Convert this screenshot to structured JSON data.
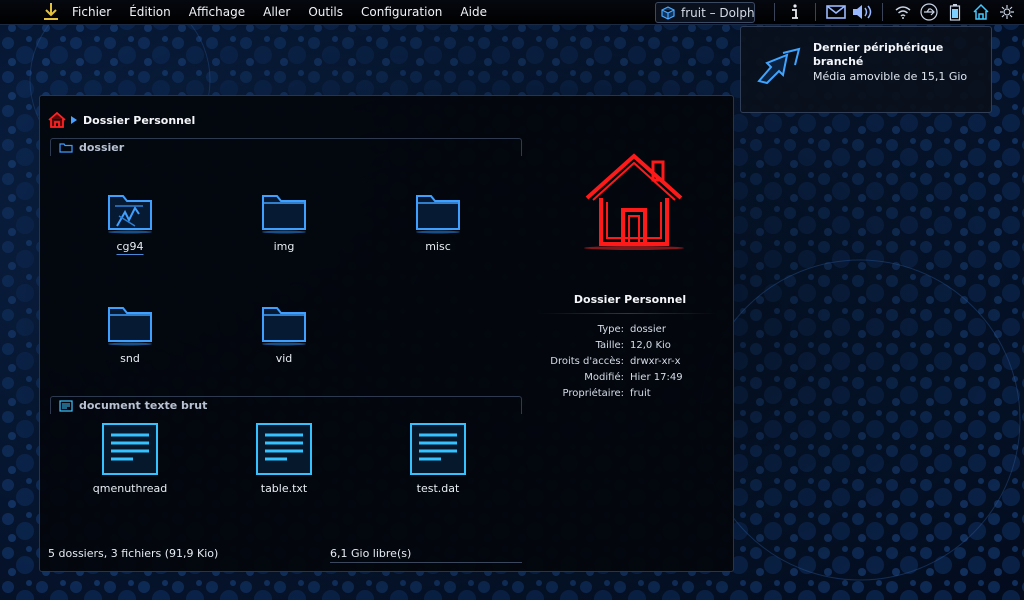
{
  "topbar": {
    "menu": [
      "Fichier",
      "Édition",
      "Affichage",
      "Aller",
      "Outils",
      "Configuration",
      "Aide"
    ],
    "task_label": "fruit – Dolphin",
    "tray_icons": [
      "info-icon",
      "mail-icon",
      "volume-icon",
      "wifi-icon",
      "usb-icon",
      "battery-icon",
      "home-icon"
    ]
  },
  "notification": {
    "title": "Dernier périphérique branché",
    "body": "Média amovible de 15,1 Gio"
  },
  "breadcrumb": {
    "label": "Dossier Personnel"
  },
  "groups": [
    {
      "header": "dossier",
      "items": [
        "cg94",
        "img",
        "misc",
        "snd",
        "vid"
      ]
    },
    {
      "header": "document texte brut",
      "items": [
        "qmenuthread",
        "table.txt",
        "test.dat"
      ]
    }
  ],
  "info_panel": {
    "title": "Dossier Personnel",
    "rows": [
      {
        "key": "Type:",
        "value": "dossier"
      },
      {
        "key": "Taille:",
        "value": "12,0 Kio"
      },
      {
        "key": "Droits d'accès:",
        "value": "drwxr-xr-x"
      },
      {
        "key": "Modifié:",
        "value": "Hier 17:49"
      },
      {
        "key": "Propriétaire:",
        "value": "fruit"
      }
    ]
  },
  "status": {
    "left": "5 dossiers, 3 fichiers (91,9 Kio)",
    "right": "6,1 Gio libre(s)"
  },
  "colors": {
    "accent_blue": "#2f8cff",
    "home_red": "#ff1a1a",
    "text_blue": "#35c2ff"
  }
}
